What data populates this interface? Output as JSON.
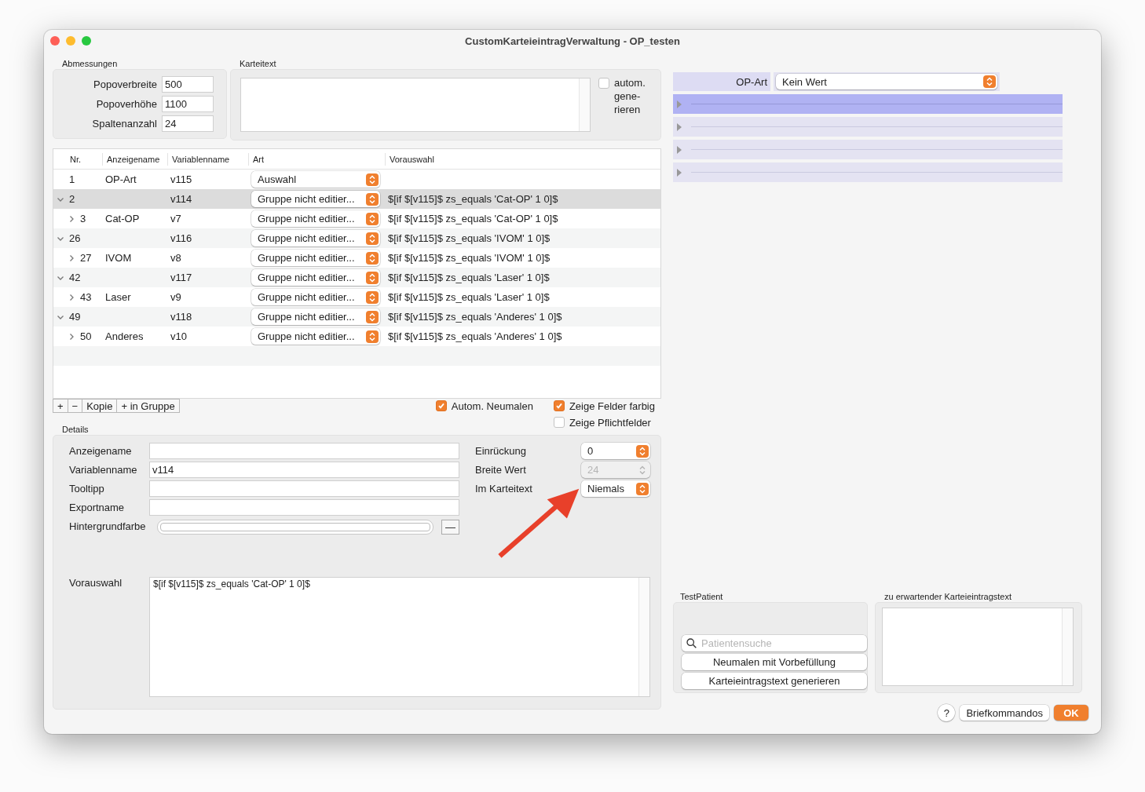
{
  "window": {
    "title": "CustomKarteieintragVerwaltung - OP_testen"
  },
  "abmessungen": {
    "title": "Abmessungen",
    "fields": [
      {
        "label": "Popoverbreite",
        "value": "500"
      },
      {
        "label": "Popoverhöhe",
        "value": "1100"
      },
      {
        "label": "Spaltenanzahl",
        "value": "24"
      }
    ]
  },
  "karteitext": {
    "title": "Karteitext",
    "auto_checkbox": {
      "label": "autom. gene-rieren",
      "checked": false
    }
  },
  "table": {
    "columns": [
      "Nr.",
      "Anzeigename",
      "Variablenname",
      "Art",
      "Vorauswahl"
    ],
    "rows": [
      {
        "kind": "leaf",
        "nr": "1",
        "anzeigename": "OP-Art",
        "variablenname": "v115",
        "art": "Auswahl",
        "vorauswahl": "",
        "selected": false
      },
      {
        "kind": "group",
        "expanded": true,
        "nr": "2",
        "anzeigename": "",
        "variablenname": "v114",
        "art": "Gruppe nicht editier...",
        "vorauswahl": "$[if $[v115]$ zs_equals 'Cat-OP' 1 0]$",
        "selected": true,
        "children": [
          {
            "kind": "group",
            "expanded": false,
            "nr": "3",
            "anzeigename": "Cat-OP",
            "variablenname": "v7",
            "art": "Gruppe nicht editier...",
            "vorauswahl": "$[if $[v115]$ zs_equals 'Cat-OP' 1 0]$",
            "selected": false
          }
        ]
      },
      {
        "kind": "group",
        "expanded": true,
        "nr": "26",
        "anzeigename": "",
        "variablenname": "v116",
        "art": "Gruppe nicht editier...",
        "vorauswahl": "$[if $[v115]$ zs_equals 'IVOM' 1 0]$",
        "selected": false,
        "children": [
          {
            "kind": "group",
            "expanded": false,
            "nr": "27",
            "anzeigename": "IVOM",
            "variablenname": "v8",
            "art": "Gruppe nicht editier...",
            "vorauswahl": "$[if $[v115]$ zs_equals 'IVOM' 1 0]$",
            "selected": false
          }
        ]
      },
      {
        "kind": "group",
        "expanded": true,
        "nr": "42",
        "anzeigename": "",
        "variablenname": "v117",
        "art": "Gruppe nicht editier...",
        "vorauswahl": "$[if $[v115]$ zs_equals 'Laser' 1 0]$",
        "selected": false,
        "children": [
          {
            "kind": "group",
            "expanded": false,
            "nr": "43",
            "anzeigename": "Laser",
            "variablenname": "v9",
            "art": "Gruppe nicht editier...",
            "vorauswahl": "$[if $[v115]$ zs_equals 'Laser' 1 0]$",
            "selected": false
          }
        ]
      },
      {
        "kind": "group",
        "expanded": true,
        "nr": "49",
        "anzeigename": "",
        "variablenname": "v118",
        "art": "Gruppe nicht editier...",
        "vorauswahl": "$[if $[v115]$ zs_equals 'Anderes' 1 0]$",
        "selected": false,
        "children": [
          {
            "kind": "group",
            "expanded": false,
            "nr": "50",
            "anzeigename": "Anderes",
            "variablenname": "v10",
            "art": "Gruppe nicht editier...",
            "vorauswahl": "$[if $[v115]$ zs_equals 'Anderes' 1 0]$",
            "selected": false
          }
        ]
      }
    ]
  },
  "table_toolbar": {
    "buttons": [
      "+",
      "−",
      "Kopie",
      "+ in Gruppe"
    ],
    "checkboxes": [
      {
        "label": "Autom. Neumalen",
        "checked": true
      },
      {
        "label": "Zeige Felder farbig",
        "checked": true
      },
      {
        "label": "Zeige Pflichtfelder",
        "checked": false
      }
    ]
  },
  "details": {
    "title": "Details",
    "fields": [
      {
        "label": "Anzeigename"
      },
      {
        "label": "Variablenname",
        "value": "v114"
      },
      {
        "label": "Tooltipp"
      },
      {
        "label": "Exportname"
      }
    ],
    "hintergrundfarbe": {
      "label": "Hintergrundfarbe",
      "button": "—"
    },
    "steppers": [
      {
        "label": "Einrückung",
        "value": "0",
        "disabled": false
      },
      {
        "label": "Breite Wert",
        "value": "24",
        "disabled": true
      },
      {
        "label": "Im Karteitext",
        "value": "Niemals",
        "disabled": false
      }
    ],
    "vorauswahl": {
      "label": "Vorauswahl",
      "value": "$[if $[v115]$ zs_equals 'Cat-OP' 1 0]$"
    }
  },
  "preview": {
    "label": "OP-Art",
    "value": "Kein Wert",
    "rows": [
      {
        "selected": true,
        "expanded": false
      },
      {
        "selected": false,
        "expanded": false
      },
      {
        "selected": false,
        "expanded": false
      },
      {
        "selected": false,
        "expanded": false
      }
    ]
  },
  "testpatient": {
    "title": "TestPatient",
    "search_placeholder": "Patientensuche",
    "buttons": [
      "Neumalen mit Vorbefüllung",
      "Karteieintragstext generieren"
    ]
  },
  "expected": {
    "title": "zu erwartender Karteieintragstext"
  },
  "footer": {
    "help": "?",
    "buttons": [
      "Briefkommandos"
    ],
    "ok": "OK"
  }
}
